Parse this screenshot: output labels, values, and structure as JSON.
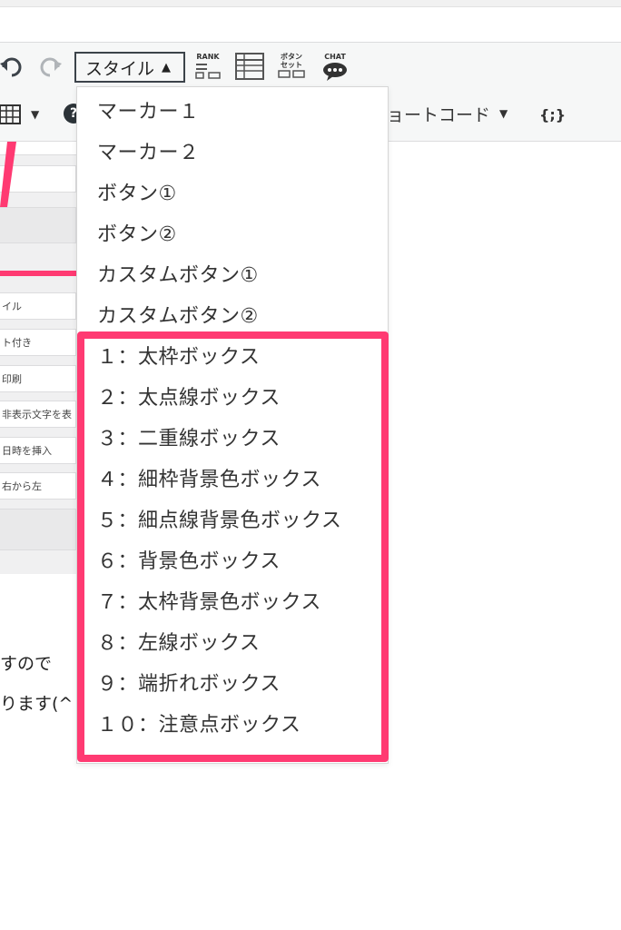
{
  "toolbar": {
    "style_select_label": "スタイル",
    "style_select_arrow": "▲",
    "rank_label": "RANK",
    "button_set_label_line1": "ボタン",
    "button_set_label_line2": "セット",
    "chat_label": "CHAT",
    "shortcode_label": "ョートコード",
    "shortcode_arrow": "▼",
    "table_arrow": "▼",
    "help_label": "?",
    "code_label": "{;}"
  },
  "left_panel": {
    "fields": [
      "イル",
      "ト付き",
      "印刷",
      "非表示文字を表",
      "日時を挿入",
      "右から左"
    ]
  },
  "body": {
    "line1": "すので",
    "line2": "ります(^"
  },
  "style_menu": {
    "items": [
      "マーカー１",
      "マーカー２",
      "ボタン①",
      "ボタン②",
      "カスタムボタン①",
      "カスタムボタン②",
      "１：太枠ボックス",
      "２：太点線ボックス",
      "３：二重線ボックス",
      "４：細枠背景色ボックス",
      "５：細点線背景色ボックス",
      "６：背景色ボックス",
      "７：太枠背景色ボックス",
      "８：左線ボックス",
      "９：端折れボックス",
      "１０：注意点ボックス"
    ]
  },
  "colors": {
    "highlight": "#ff3a72",
    "toolbar_bg": "#f6f7f7"
  }
}
